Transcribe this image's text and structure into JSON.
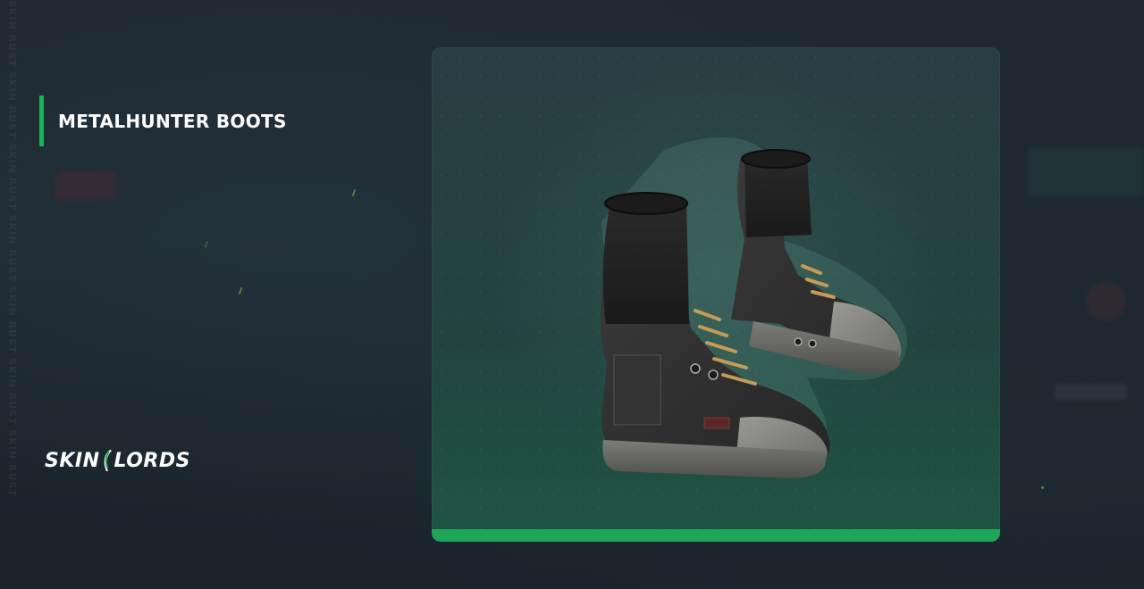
{
  "item": {
    "name": "METALHUNTER BOOTS"
  },
  "brand": {
    "name_left": "SKIN",
    "name_right": "LORDS",
    "accent_color": "#22b05a"
  },
  "watermark": {
    "text": "SKIN RUST SKIN RUST SKIN RUST SKIN RUST SKIN RUST SKIN RUST SKIN RUST"
  },
  "image": {
    "icon": "boots-image"
  }
}
